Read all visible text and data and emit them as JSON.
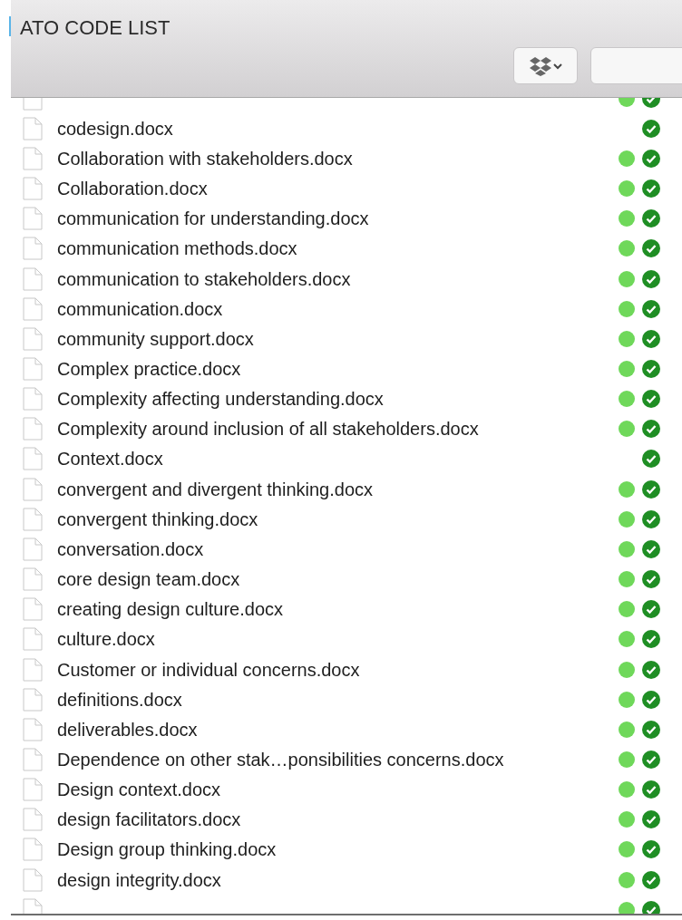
{
  "window": {
    "title": "ATO CODE LIST"
  },
  "files": [
    {
      "synced": true
    },
    {
      "name": "codesign.docx",
      "synced": false
    },
    {
      "name": "Collaboration with stakeholders.docx",
      "synced": true
    },
    {
      "name": "Collaboration.docx",
      "synced": true
    },
    {
      "name": "communication for understanding.docx",
      "synced": true
    },
    {
      "name": "communication methods.docx",
      "synced": true
    },
    {
      "name": "communication to stakeholders.docx",
      "synced": true
    },
    {
      "name": "communication.docx",
      "synced": true
    },
    {
      "name": "community support.docx",
      "synced": true
    },
    {
      "name": "Complex practice.docx",
      "synced": true
    },
    {
      "name": "Complexity affecting understanding.docx",
      "synced": true
    },
    {
      "name": "Complexity around inclusion of all stakeholders.docx",
      "synced": true
    },
    {
      "name": "Context.docx",
      "synced": false
    },
    {
      "name": "convergent and divergent thinking.docx",
      "synced": true
    },
    {
      "name": "convergent thinking.docx",
      "synced": true
    },
    {
      "name": "conversation.docx",
      "synced": true
    },
    {
      "name": "core design team.docx",
      "synced": true
    },
    {
      "name": "creating design culture.docx",
      "synced": true
    },
    {
      "name": "culture.docx",
      "synced": true
    },
    {
      "name": "Customer or individual concerns.docx",
      "synced": true
    },
    {
      "name": "definitions.docx",
      "synced": true
    },
    {
      "name": "deliverables.docx",
      "synced": true
    },
    {
      "name": "Dependence on other stak…ponsibilities concerns.docx",
      "synced": true
    },
    {
      "name": "Design context.docx",
      "synced": true
    },
    {
      "name": "design facilitators.docx",
      "synced": true
    },
    {
      "name": "Design group thinking.docx",
      "synced": true
    },
    {
      "name": "design integrity.docx",
      "synced": true
    },
    {
      "synced": true
    }
  ]
}
